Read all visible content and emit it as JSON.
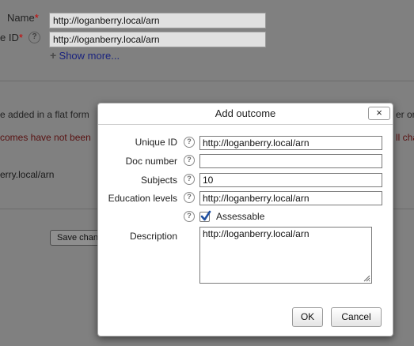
{
  "background": {
    "name_label": "Name",
    "idnumber_label": "e ID",
    "required_mark": "*",
    "name_value": "http://loganberry.local/arn",
    "idnumber_value": "http://loganberry.local/arn",
    "show_more_label": "Show more...",
    "flat_form_text": "e added in a flat form",
    "flat_form_right": "er or",
    "outcomes_text": "comes have not been",
    "outcomes_right": "ll cha",
    "short_text": "erry.local/arn",
    "save_button_label": "Save chan",
    "help_glyph": "?"
  },
  "dialog": {
    "title": "Add outcome",
    "close_glyph": "×",
    "help_glyph": "?",
    "fields": {
      "unique_id": {
        "label": "Unique ID",
        "value": "http://loganberry.local/arn"
      },
      "doc_number": {
        "label": "Doc number",
        "value": ""
      },
      "subjects": {
        "label": "Subjects",
        "value": "10"
      },
      "education_levels": {
        "label": "Education levels",
        "value": "http://loganberry.local/arn"
      }
    },
    "assessable": {
      "label": "Assessable",
      "checked": true
    },
    "description": {
      "label": "Description",
      "value": "http://loganberry.local/arn"
    },
    "ok_label": "OK",
    "cancel_label": "Cancel"
  }
}
